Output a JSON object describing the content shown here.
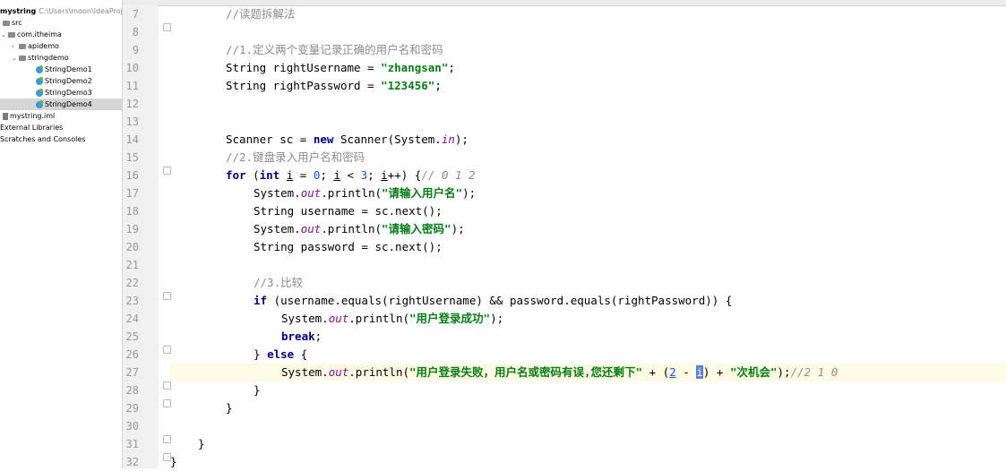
{
  "project": {
    "root_name": "mystring",
    "root_path": "C:\\Users\\moon\\IdeaProje",
    "items": [
      {
        "label": "src",
        "kind": "folder"
      },
      {
        "label": "com.itheima",
        "kind": "package"
      },
      {
        "label": "apidemo",
        "kind": "package"
      },
      {
        "label": "stringdemo",
        "kind": "package"
      },
      {
        "label": "StringDemo1",
        "kind": "class"
      },
      {
        "label": "StringDemo2",
        "kind": "class"
      },
      {
        "label": "StringDemo3",
        "kind": "class"
      },
      {
        "label": "StringDemo4",
        "kind": "class",
        "selected": true
      },
      {
        "label": "mystring.iml",
        "kind": "iml"
      },
      {
        "label": "External Libraries",
        "kind": "lib"
      },
      {
        "label": "Scratches and Consoles",
        "kind": "scratch"
      }
    ]
  },
  "editor": {
    "line_numbers": [
      "7",
      "8",
      "9",
      "10",
      "11",
      "12",
      "13",
      "14",
      "15",
      "16",
      "17",
      "18",
      "19",
      "20",
      "21",
      "22",
      "23",
      "24",
      "25",
      "26",
      "27",
      "28",
      "29",
      "30",
      "31",
      "32"
    ],
    "current_line": "27",
    "code": {
      "l7": "//读题拆解法",
      "l9": "//1.定义两个变量记录正确的用户名和密码",
      "l10_type": "String",
      "l10_name": " rightUsername = ",
      "l10_val": "\"zhangsan\"",
      "l11_type": "String",
      "l11_name": " rightPassword = ",
      "l11_val": "\"123456\"",
      "l14_a": "Scanner sc = ",
      "l14_new": "new",
      "l14_b": " Scanner(System.",
      "l14_in": "in",
      "l14_c": ");",
      "l15": "//2.键盘录入用户名和密码",
      "l16_for": "for",
      "l16_a": " (",
      "l16_int": "int",
      "l16_i1": "i",
      "l16_b": " = ",
      "l16_n0": "0",
      "l16_i2": "i",
      "l16_c": " < ",
      "l16_n3": "3",
      "l16_i3": "i",
      "l16_d": "++) {",
      "l16_cm": "// 0 1 2",
      "l17_a": "System.",
      "l17_out": "out",
      "l17_b": ".println(",
      "l17_str": "\"请输入用户名\"",
      "l18": "String username = sc.next();",
      "l19_a": "System.",
      "l19_out": "out",
      "l19_b": ".println(",
      "l19_str": "\"请输入密码\"",
      "l20": "String password = sc.next();",
      "l22": "//3.比较",
      "l23_if": "if",
      "l23_rest": " (username.equals(rightUsername) && password.equals(rightPassword)) {",
      "l24_a": "System.",
      "l24_out": "out",
      "l24_b": ".println(",
      "l24_str": "\"用户登录成功\"",
      "l25": "break",
      "l26_a": "} ",
      "l26_else": "else",
      "l26_b": " {",
      "l27_a": "System.",
      "l27_out": "out",
      "l27_b": ".println(",
      "l27_str1": "\"用户登录失败，用户名或密码有误,您还剩下\"",
      "l27_c": " + (",
      "l27_n2": "2",
      "l27_d": " - ",
      "l27_i": "i",
      "l27_e": ") + ",
      "l27_str2": "\"次机会\"",
      "l27_f": ");",
      "l27_cm": "//2 1 0",
      "l28": "}",
      "l29": "}",
      "l31": "}",
      "l32": "}"
    }
  },
  "colors": {
    "keyword": "#000080",
    "string": "#067d17",
    "comment": "#8c8c8c",
    "field": "#871094",
    "number": "#1750eb",
    "current_line_bg": "#fffae3"
  }
}
